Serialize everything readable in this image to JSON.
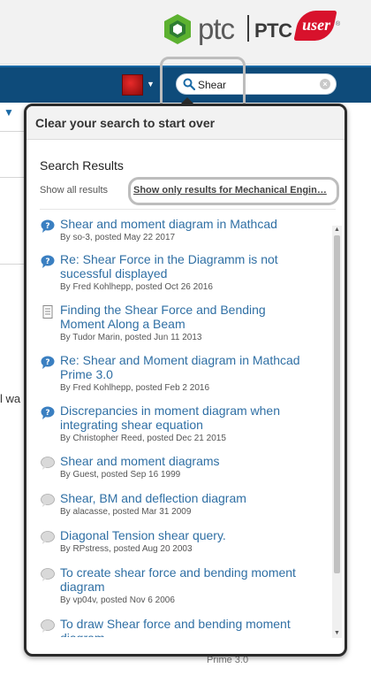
{
  "header": {
    "logo_ptc": "ptc",
    "logo_ptc_caps": "PTC",
    "logo_user": "user",
    "logo_reg": "®"
  },
  "navbar": {
    "search": {
      "value": "Shear",
      "clear_label": "×"
    }
  },
  "background": {
    "partial_text": "l wa",
    "partial_bottom": "Prime 3.0"
  },
  "popup": {
    "header_text": "Clear your search to start over",
    "results_title": "Search Results",
    "show_all": "Show all results",
    "show_only": "Show only results for Mechanical Engin…",
    "results": [
      {
        "icon": "question-icon",
        "title": "Shear and moment diagram in Mathcad",
        "meta": "By so-3, posted May 22 2017"
      },
      {
        "icon": "question-icon",
        "title": "Re: Shear Force in the Diagramm is not sucessful displayed",
        "meta": "By Fred Kohlhepp, posted Oct 26 2016"
      },
      {
        "icon": "document-icon",
        "title": "Finding the Shear Force and Bending Moment Along a Beam",
        "meta": "By Tudor Marin, posted Jun 11 2013"
      },
      {
        "icon": "question-icon",
        "title": "Re: Shear and Moment diagram in Mathcad Prime 3.0",
        "meta": "By Fred Kohlhepp, posted Feb 2 2016"
      },
      {
        "icon": "question-icon",
        "title": "Discrepancies in moment diagram when integrating shear equation",
        "meta": "By Christopher Reed, posted Dec 21 2015"
      },
      {
        "icon": "discussion-icon",
        "title": "Shear and moment diagrams",
        "meta": "By Guest, posted Sep 16 1999"
      },
      {
        "icon": "discussion-icon",
        "title": "Shear, BM and deflection diagram",
        "meta": "By alacasse, posted Mar 31 2009"
      },
      {
        "icon": "discussion-icon",
        "title": "Diagonal Tension shear query.",
        "meta": "By RPstress, posted Aug 20 2003"
      },
      {
        "icon": "discussion-icon",
        "title": "To create shear force and bending moment diagram",
        "meta": "By vp04v, posted Nov 6 2006"
      },
      {
        "icon": "discussion-icon",
        "title": "To draw Shear force and bending moment diagram",
        "meta": ""
      }
    ]
  },
  "colors": {
    "nav_blue": "#0e4b7a",
    "link_blue": "#2f6fa4",
    "brand_green": "#5cb130",
    "brand_red": "#d8122c"
  }
}
